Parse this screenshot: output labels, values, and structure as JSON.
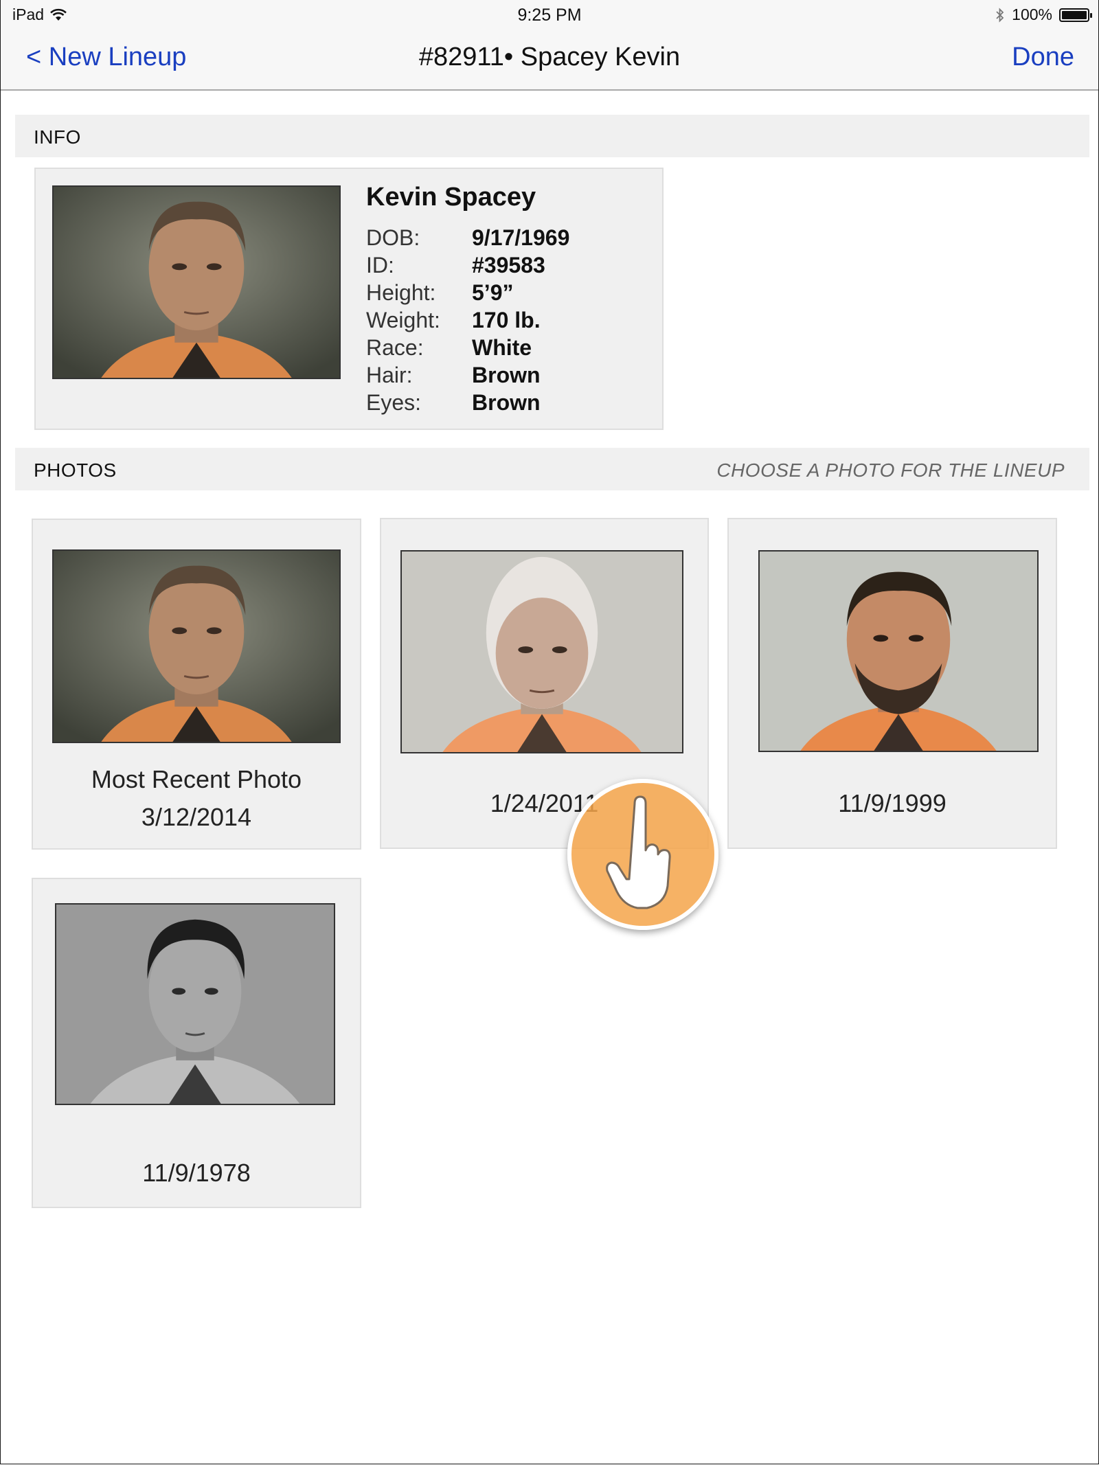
{
  "status_bar": {
    "device": "iPad",
    "time": "9:25 PM",
    "battery_percent_label": "100%",
    "battery_level": 1.0,
    "icons": [
      "wifi-icon",
      "bluetooth-icon",
      "battery-icon"
    ]
  },
  "nav": {
    "back_label": "< New Lineup",
    "title": "#82911• Spacey Kevin",
    "done_label": "Done"
  },
  "info_section": {
    "header": "INFO",
    "name": "Kevin Spacey",
    "fields": [
      {
        "label": "DOB:",
        "value": "9/17/1969"
      },
      {
        "label": "ID:",
        "value": "#39583"
      },
      {
        "label": "Height:",
        "value": "5’9”"
      },
      {
        "label": "Weight:",
        "value": "170 lb."
      },
      {
        "label": "Race:",
        "value": "White"
      },
      {
        "label": "Hair:",
        "value": "Brown"
      },
      {
        "label": "Eyes:",
        "value": "Brown"
      }
    ]
  },
  "photos_section": {
    "header": "PHOTOS",
    "hint": "CHOOSE A PHOTO FOR THE LINEUP",
    "photos": [
      {
        "caption": "Most Recent Photo",
        "date": "3/12/2014"
      },
      {
        "caption": "",
        "date": "1/24/2011"
      },
      {
        "caption": "",
        "date": "11/9/1999"
      },
      {
        "caption": "",
        "date": "11/9/1978"
      }
    ]
  },
  "colors": {
    "accent": "#1a3fc0",
    "card_bg": "#f0f0f0",
    "touch_indicator": "#f4a44a",
    "uniform_orange": "#e8894a"
  }
}
